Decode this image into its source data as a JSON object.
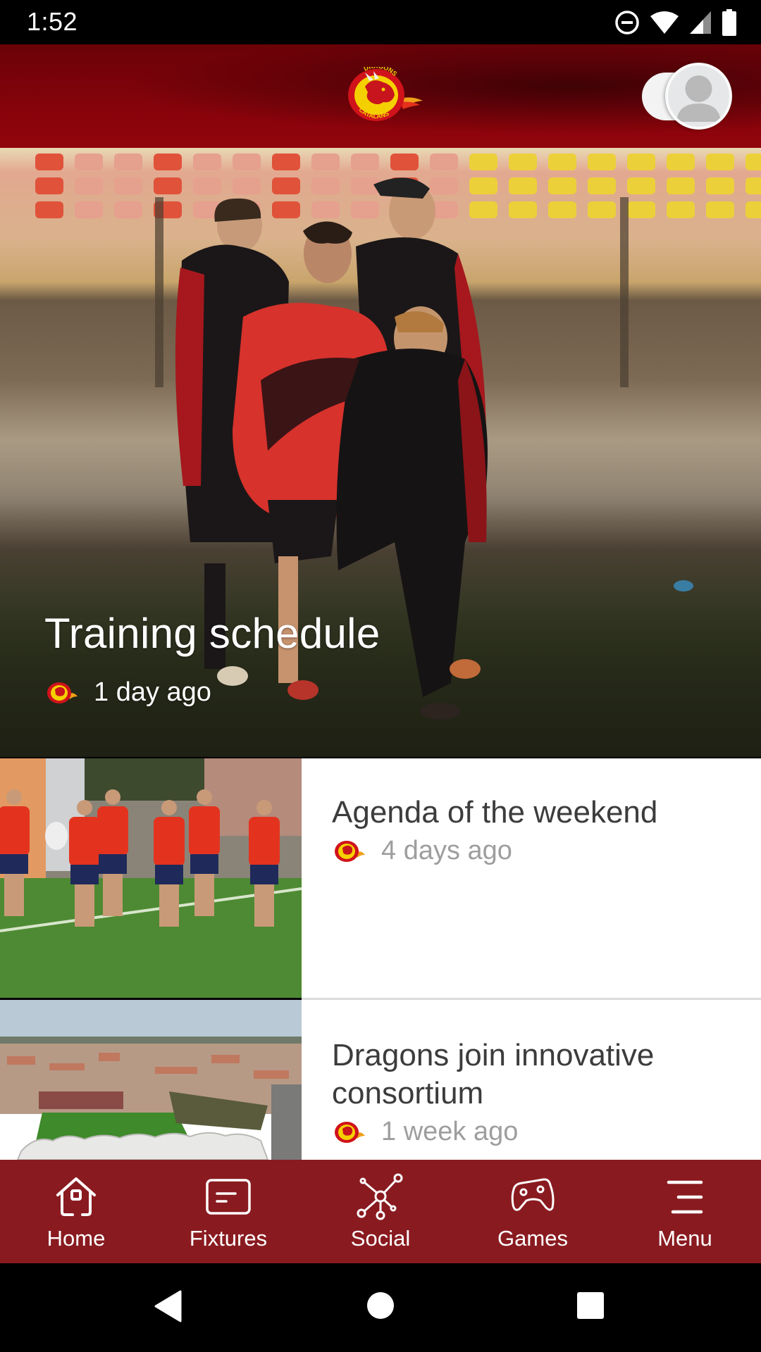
{
  "status_bar": {
    "time": "1:52",
    "icons": [
      "do-not-disturb-icon",
      "wifi-icon",
      "cell-signal-icon",
      "battery-icon"
    ]
  },
  "header": {
    "logo_text_top": "DRAGONS",
    "logo_text_bottom": "CATALANS",
    "profile_toggle": "profile-avatar-toggle"
  },
  "colors": {
    "header_red": "#8a030b",
    "nav_red": "#891b20",
    "title_text": "#3c3c3c",
    "meta_text": "#9e9e9e",
    "logo_yellow": "#f5d000",
    "logo_red": "#d0121b"
  },
  "hero": {
    "title": "Training schedule",
    "time": "1 day ago"
  },
  "articles": [
    {
      "title": "Agenda of the weekend",
      "time": "4 days ago"
    },
    {
      "title": "Dragons join innovative consortium",
      "time": "1 week ago"
    }
  ],
  "bottom_nav": {
    "items": [
      {
        "label": "Home",
        "icon": "home-icon"
      },
      {
        "label": "Fixtures",
        "icon": "fixtures-icon"
      },
      {
        "label": "Social",
        "icon": "social-network-icon"
      },
      {
        "label": "Games",
        "icon": "gamepad-icon"
      },
      {
        "label": "Menu",
        "icon": "menu-icon"
      }
    ]
  },
  "system_nav": [
    "back",
    "home",
    "recents"
  ]
}
